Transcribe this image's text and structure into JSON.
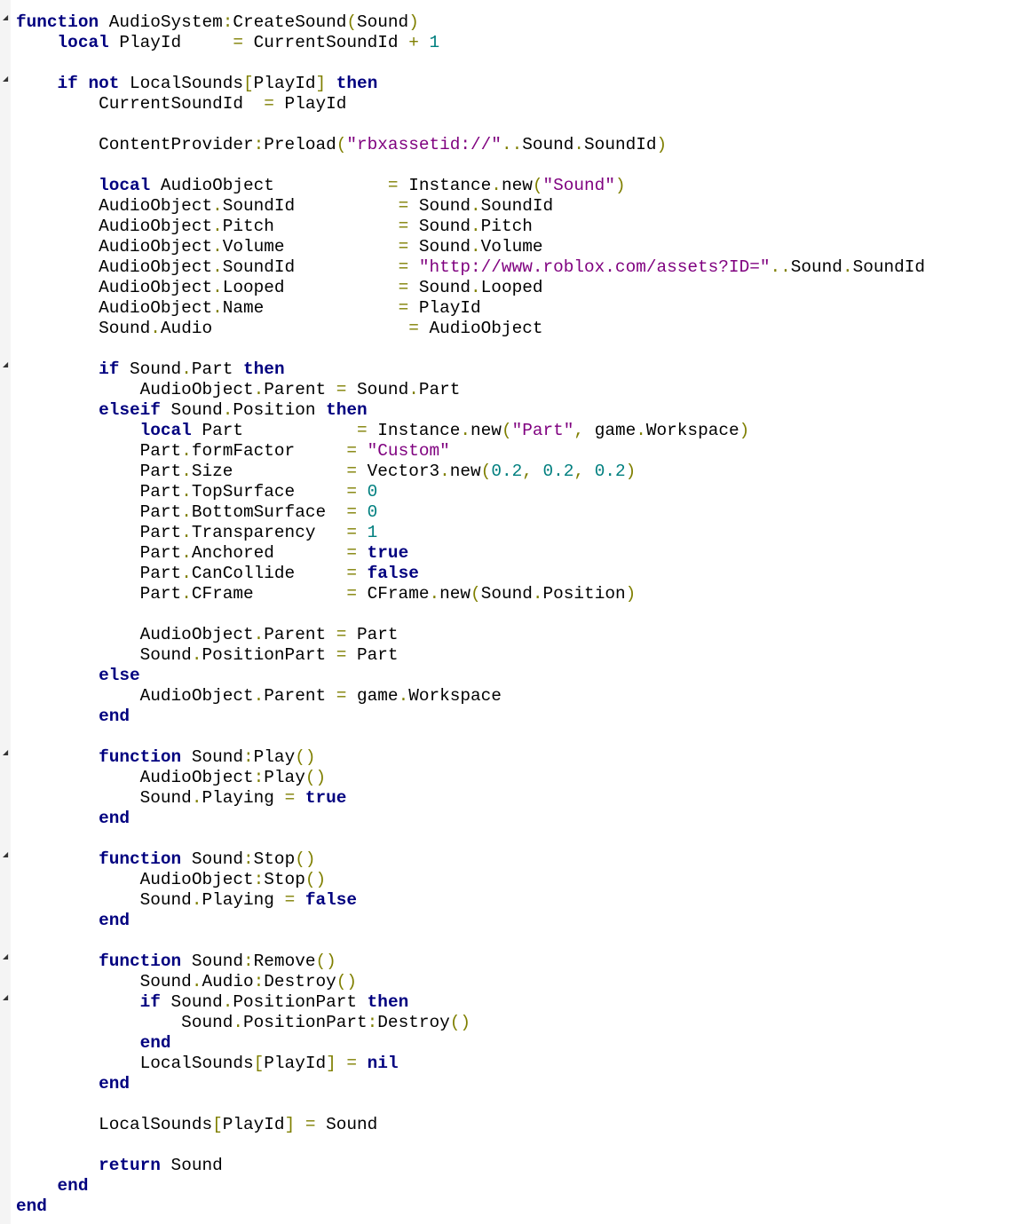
{
  "editor": {
    "language": "lua",
    "fold_marker_lines": [
      1,
      4,
      18,
      37,
      42,
      47,
      49
    ],
    "colors": {
      "background": "#ffffff",
      "gutter": "#f4f4f4",
      "plain": "#000000",
      "keyword": "#00007f",
      "operator": "#7f7f00",
      "string": "#7f007f",
      "number": "#007f7f"
    },
    "fold_icon": "fold-triangle-icon",
    "lines": [
      [
        [
          "k",
          "function"
        ],
        [
          "p",
          " AudioSystem"
        ],
        [
          "o",
          ":"
        ],
        [
          "p",
          "CreateSound"
        ],
        [
          "o",
          "("
        ],
        [
          "p",
          "Sound"
        ],
        [
          "o",
          ")"
        ]
      ],
      [
        [
          "p",
          "    "
        ],
        [
          "k",
          "local"
        ],
        [
          "p",
          " PlayId     "
        ],
        [
          "o",
          "="
        ],
        [
          "p",
          " CurrentSoundId "
        ],
        [
          "o",
          "+"
        ],
        [
          "p",
          " "
        ],
        [
          "n",
          "1"
        ]
      ],
      [],
      [
        [
          "p",
          "    "
        ],
        [
          "k",
          "if"
        ],
        [
          "p",
          " "
        ],
        [
          "k",
          "not"
        ],
        [
          "p",
          " LocalSounds"
        ],
        [
          "o",
          "["
        ],
        [
          "p",
          "PlayId"
        ],
        [
          "o",
          "]"
        ],
        [
          "p",
          " "
        ],
        [
          "k",
          "then"
        ]
      ],
      [
        [
          "p",
          "        CurrentSoundId  "
        ],
        [
          "o",
          "="
        ],
        [
          "p",
          " PlayId"
        ]
      ],
      [],
      [
        [
          "p",
          "        ContentProvider"
        ],
        [
          "o",
          ":"
        ],
        [
          "p",
          "Preload"
        ],
        [
          "o",
          "("
        ],
        [
          "s",
          "\"rbxassetid://\""
        ],
        [
          "o",
          ".."
        ],
        [
          "p",
          "Sound"
        ],
        [
          "o",
          "."
        ],
        [
          "p",
          "SoundId"
        ],
        [
          "o",
          ")"
        ]
      ],
      [],
      [
        [
          "p",
          "        "
        ],
        [
          "k",
          "local"
        ],
        [
          "p",
          " AudioObject           "
        ],
        [
          "o",
          "="
        ],
        [
          "p",
          " Instance"
        ],
        [
          "o",
          "."
        ],
        [
          "p",
          "new"
        ],
        [
          "o",
          "("
        ],
        [
          "s",
          "\"Sound\""
        ],
        [
          "o",
          ")"
        ]
      ],
      [
        [
          "p",
          "        AudioObject"
        ],
        [
          "o",
          "."
        ],
        [
          "p",
          "SoundId          "
        ],
        [
          "o",
          "="
        ],
        [
          "p",
          " Sound"
        ],
        [
          "o",
          "."
        ],
        [
          "p",
          "SoundId"
        ]
      ],
      [
        [
          "p",
          "        AudioObject"
        ],
        [
          "o",
          "."
        ],
        [
          "p",
          "Pitch            "
        ],
        [
          "o",
          "="
        ],
        [
          "p",
          " Sound"
        ],
        [
          "o",
          "."
        ],
        [
          "p",
          "Pitch"
        ]
      ],
      [
        [
          "p",
          "        AudioObject"
        ],
        [
          "o",
          "."
        ],
        [
          "p",
          "Volume           "
        ],
        [
          "o",
          "="
        ],
        [
          "p",
          " Sound"
        ],
        [
          "o",
          "."
        ],
        [
          "p",
          "Volume"
        ]
      ],
      [
        [
          "p",
          "        AudioObject"
        ],
        [
          "o",
          "."
        ],
        [
          "p",
          "SoundId          "
        ],
        [
          "o",
          "="
        ],
        [
          "p",
          " "
        ],
        [
          "s",
          "\"http://www.roblox.com/assets?ID=\""
        ],
        [
          "o",
          ".."
        ],
        [
          "p",
          "Sound"
        ],
        [
          "o",
          "."
        ],
        [
          "p",
          "SoundId"
        ]
      ],
      [
        [
          "p",
          "        AudioObject"
        ],
        [
          "o",
          "."
        ],
        [
          "p",
          "Looped           "
        ],
        [
          "o",
          "="
        ],
        [
          "p",
          " Sound"
        ],
        [
          "o",
          "."
        ],
        [
          "p",
          "Looped"
        ]
      ],
      [
        [
          "p",
          "        AudioObject"
        ],
        [
          "o",
          "."
        ],
        [
          "p",
          "Name             "
        ],
        [
          "o",
          "="
        ],
        [
          "p",
          " PlayId"
        ]
      ],
      [
        [
          "p",
          "        Sound"
        ],
        [
          "o",
          "."
        ],
        [
          "p",
          "Audio                   "
        ],
        [
          "o",
          "="
        ],
        [
          "p",
          " AudioObject"
        ]
      ],
      [],
      [
        [
          "p",
          "        "
        ],
        [
          "k",
          "if"
        ],
        [
          "p",
          " Sound"
        ],
        [
          "o",
          "."
        ],
        [
          "p",
          "Part "
        ],
        [
          "k",
          "then"
        ]
      ],
      [
        [
          "p",
          "            AudioObject"
        ],
        [
          "o",
          "."
        ],
        [
          "p",
          "Parent "
        ],
        [
          "o",
          "="
        ],
        [
          "p",
          " Sound"
        ],
        [
          "o",
          "."
        ],
        [
          "p",
          "Part"
        ]
      ],
      [
        [
          "p",
          "        "
        ],
        [
          "k",
          "elseif"
        ],
        [
          "p",
          " Sound"
        ],
        [
          "o",
          "."
        ],
        [
          "p",
          "Position "
        ],
        [
          "k",
          "then"
        ]
      ],
      [
        [
          "p",
          "            "
        ],
        [
          "k",
          "local"
        ],
        [
          "p",
          " Part           "
        ],
        [
          "o",
          "="
        ],
        [
          "p",
          " Instance"
        ],
        [
          "o",
          "."
        ],
        [
          "p",
          "new"
        ],
        [
          "o",
          "("
        ],
        [
          "s",
          "\"Part\""
        ],
        [
          "o",
          ","
        ],
        [
          "p",
          " game"
        ],
        [
          "o",
          "."
        ],
        [
          "p",
          "Workspace"
        ],
        [
          "o",
          ")"
        ]
      ],
      [
        [
          "p",
          "            Part"
        ],
        [
          "o",
          "."
        ],
        [
          "p",
          "formFactor     "
        ],
        [
          "o",
          "="
        ],
        [
          "p",
          " "
        ],
        [
          "s",
          "\"Custom\""
        ]
      ],
      [
        [
          "p",
          "            Part"
        ],
        [
          "o",
          "."
        ],
        [
          "p",
          "Size           "
        ],
        [
          "o",
          "="
        ],
        [
          "p",
          " Vector3"
        ],
        [
          "o",
          "."
        ],
        [
          "p",
          "new"
        ],
        [
          "o",
          "("
        ],
        [
          "n",
          "0.2"
        ],
        [
          "o",
          ","
        ],
        [
          "p",
          " "
        ],
        [
          "n",
          "0.2"
        ],
        [
          "o",
          ","
        ],
        [
          "p",
          " "
        ],
        [
          "n",
          "0.2"
        ],
        [
          "o",
          ")"
        ]
      ],
      [
        [
          "p",
          "            Part"
        ],
        [
          "o",
          "."
        ],
        [
          "p",
          "TopSurface     "
        ],
        [
          "o",
          "="
        ],
        [
          "p",
          " "
        ],
        [
          "n",
          "0"
        ]
      ],
      [
        [
          "p",
          "            Part"
        ],
        [
          "o",
          "."
        ],
        [
          "p",
          "BottomSurface  "
        ],
        [
          "o",
          "="
        ],
        [
          "p",
          " "
        ],
        [
          "n",
          "0"
        ]
      ],
      [
        [
          "p",
          "            Part"
        ],
        [
          "o",
          "."
        ],
        [
          "p",
          "Transparency   "
        ],
        [
          "o",
          "="
        ],
        [
          "p",
          " "
        ],
        [
          "n",
          "1"
        ]
      ],
      [
        [
          "p",
          "            Part"
        ],
        [
          "o",
          "."
        ],
        [
          "p",
          "Anchored       "
        ],
        [
          "o",
          "="
        ],
        [
          "p",
          " "
        ],
        [
          "k",
          "true"
        ]
      ],
      [
        [
          "p",
          "            Part"
        ],
        [
          "o",
          "."
        ],
        [
          "p",
          "CanCollide     "
        ],
        [
          "o",
          "="
        ],
        [
          "p",
          " "
        ],
        [
          "k",
          "false"
        ]
      ],
      [
        [
          "p",
          "            Part"
        ],
        [
          "o",
          "."
        ],
        [
          "p",
          "CFrame         "
        ],
        [
          "o",
          "="
        ],
        [
          "p",
          " CFrame"
        ],
        [
          "o",
          "."
        ],
        [
          "p",
          "new"
        ],
        [
          "o",
          "("
        ],
        [
          "p",
          "Sound"
        ],
        [
          "o",
          "."
        ],
        [
          "p",
          "Position"
        ],
        [
          "o",
          ")"
        ]
      ],
      [],
      [
        [
          "p",
          "            AudioObject"
        ],
        [
          "o",
          "."
        ],
        [
          "p",
          "Parent "
        ],
        [
          "o",
          "="
        ],
        [
          "p",
          " Part"
        ]
      ],
      [
        [
          "p",
          "            Sound"
        ],
        [
          "o",
          "."
        ],
        [
          "p",
          "PositionPart "
        ],
        [
          "o",
          "="
        ],
        [
          "p",
          " Part"
        ]
      ],
      [
        [
          "p",
          "        "
        ],
        [
          "k",
          "else"
        ]
      ],
      [
        [
          "p",
          "            AudioObject"
        ],
        [
          "o",
          "."
        ],
        [
          "p",
          "Parent "
        ],
        [
          "o",
          "="
        ],
        [
          "p",
          " game"
        ],
        [
          "o",
          "."
        ],
        [
          "p",
          "Workspace"
        ]
      ],
      [
        [
          "p",
          "        "
        ],
        [
          "k",
          "end"
        ]
      ],
      [],
      [
        [
          "p",
          "        "
        ],
        [
          "k",
          "function"
        ],
        [
          "p",
          " Sound"
        ],
        [
          "o",
          ":"
        ],
        [
          "p",
          "Play"
        ],
        [
          "o",
          "()"
        ]
      ],
      [
        [
          "p",
          "            AudioObject"
        ],
        [
          "o",
          ":"
        ],
        [
          "p",
          "Play"
        ],
        [
          "o",
          "()"
        ]
      ],
      [
        [
          "p",
          "            Sound"
        ],
        [
          "o",
          "."
        ],
        [
          "p",
          "Playing "
        ],
        [
          "o",
          "="
        ],
        [
          "p",
          " "
        ],
        [
          "k",
          "true"
        ]
      ],
      [
        [
          "p",
          "        "
        ],
        [
          "k",
          "end"
        ]
      ],
      [],
      [
        [
          "p",
          "        "
        ],
        [
          "k",
          "function"
        ],
        [
          "p",
          " Sound"
        ],
        [
          "o",
          ":"
        ],
        [
          "p",
          "Stop"
        ],
        [
          "o",
          "()"
        ]
      ],
      [
        [
          "p",
          "            AudioObject"
        ],
        [
          "o",
          ":"
        ],
        [
          "p",
          "Stop"
        ],
        [
          "o",
          "()"
        ]
      ],
      [
        [
          "p",
          "            Sound"
        ],
        [
          "o",
          "."
        ],
        [
          "p",
          "Playing "
        ],
        [
          "o",
          "="
        ],
        [
          "p",
          " "
        ],
        [
          "k",
          "false"
        ]
      ],
      [
        [
          "p",
          "        "
        ],
        [
          "k",
          "end"
        ]
      ],
      [],
      [
        [
          "p",
          "        "
        ],
        [
          "k",
          "function"
        ],
        [
          "p",
          " Sound"
        ],
        [
          "o",
          ":"
        ],
        [
          "p",
          "Remove"
        ],
        [
          "o",
          "()"
        ]
      ],
      [
        [
          "p",
          "            Sound"
        ],
        [
          "o",
          "."
        ],
        [
          "p",
          "Audio"
        ],
        [
          "o",
          ":"
        ],
        [
          "p",
          "Destroy"
        ],
        [
          "o",
          "()"
        ]
      ],
      [
        [
          "p",
          "            "
        ],
        [
          "k",
          "if"
        ],
        [
          "p",
          " Sound"
        ],
        [
          "o",
          "."
        ],
        [
          "p",
          "PositionPart "
        ],
        [
          "k",
          "then"
        ]
      ],
      [
        [
          "p",
          "                Sound"
        ],
        [
          "o",
          "."
        ],
        [
          "p",
          "PositionPart"
        ],
        [
          "o",
          ":"
        ],
        [
          "p",
          "Destroy"
        ],
        [
          "o",
          "()"
        ]
      ],
      [
        [
          "p",
          "            "
        ],
        [
          "k",
          "end"
        ]
      ],
      [
        [
          "p",
          "            LocalSounds"
        ],
        [
          "o",
          "["
        ],
        [
          "p",
          "PlayId"
        ],
        [
          "o",
          "]"
        ],
        [
          "p",
          " "
        ],
        [
          "o",
          "="
        ],
        [
          "p",
          " "
        ],
        [
          "k",
          "nil"
        ]
      ],
      [
        [
          "p",
          "        "
        ],
        [
          "k",
          "end"
        ]
      ],
      [],
      [
        [
          "p",
          "        LocalSounds"
        ],
        [
          "o",
          "["
        ],
        [
          "p",
          "PlayId"
        ],
        [
          "o",
          "]"
        ],
        [
          "p",
          " "
        ],
        [
          "o",
          "="
        ],
        [
          "p",
          " Sound"
        ]
      ],
      [],
      [
        [
          "p",
          "        "
        ],
        [
          "k",
          "return"
        ],
        [
          "p",
          " Sound"
        ]
      ],
      [
        [
          "p",
          "    "
        ],
        [
          "k",
          "end"
        ]
      ],
      [
        [
          "k",
          "end"
        ]
      ]
    ]
  }
}
